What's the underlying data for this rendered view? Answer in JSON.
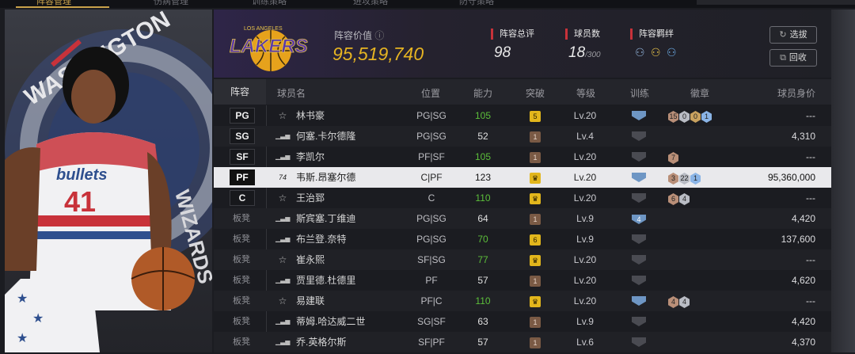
{
  "top_tabs": [
    "阵容管理",
    "伤病管理",
    "训练策略",
    "进攻策略",
    "防守策略"
  ],
  "team": {
    "logo_text": "LAKERS",
    "logo_sub": "LOS ANGELES",
    "lineup_value_label": "阵容价值",
    "lineup_value": "95,519,740",
    "rating_label": "阵容总评",
    "rating": "98",
    "players_label": "球员数",
    "players_count": "18",
    "players_max": "/300",
    "bond_label": "阵容羁绊",
    "bond_icons": [
      "bond-icon-1",
      "bond-icon-2",
      "bond-icon-3"
    ]
  },
  "buttons": {
    "pick": "选拔",
    "recycle": "回收"
  },
  "hero": {
    "jersey_text": "bullets",
    "jersey_number": "41",
    "backdrop_text": "WASHINGTON",
    "backdrop_text2": "WIZARDS"
  },
  "columns": [
    "阵容",
    "球员名",
    "位置",
    "能力",
    "突破",
    "等级",
    "训练",
    "徽章",
    "球员身价"
  ],
  "rows": [
    {
      "slot": "PG",
      "starter": true,
      "icon": "star",
      "name": "林书豪",
      "pos": "PG|SG",
      "ability": "105",
      "ability_color": "green",
      "brk": "5",
      "brk_type": "gold",
      "level": "Lv.20",
      "train": "",
      "train_type": "blue",
      "badges": [
        {
          "t": "15",
          "c": "bronze"
        },
        {
          "t": "0",
          "c": "silver"
        },
        {
          "t": "0",
          "c": "gold"
        },
        {
          "t": "1",
          "c": "blue"
        }
      ],
      "value": "---"
    },
    {
      "slot": "SG",
      "starter": true,
      "icon": "bars",
      "name": "何塞.卡尔德隆",
      "pos": "PG|SG",
      "ability": "52",
      "ability_color": "white",
      "brk": "1",
      "brk_type": "brown",
      "level": "Lv.4",
      "train": "",
      "train_type": "gray",
      "badges": [],
      "value": "4,310"
    },
    {
      "slot": "SF",
      "starter": true,
      "icon": "bars",
      "name": "李凯尔",
      "pos": "PF|SF",
      "ability": "105",
      "ability_color": "green",
      "brk": "1",
      "brk_type": "brown",
      "level": "Lv.20",
      "train": "",
      "train_type": "gray",
      "badges": [
        {
          "t": "7",
          "c": "bronze"
        }
      ],
      "value": "---"
    },
    {
      "slot": "PF",
      "starter": true,
      "icon": "74",
      "name": "韦斯.昂塞尔德",
      "pos": "C|PF",
      "ability": "123",
      "ability_color": "white",
      "brk": "♛",
      "brk_type": "gold",
      "level": "Lv.20",
      "train": "",
      "train_type": "blue",
      "badges": [
        {
          "t": "3",
          "c": "bronze"
        },
        {
          "t": "22",
          "c": "silver"
        },
        {
          "t": "1",
          "c": "blue"
        }
      ],
      "value": "95,360,000",
      "highlight": true
    },
    {
      "slot": "C",
      "starter": true,
      "icon": "star",
      "name": "王治郅",
      "pos": "C",
      "ability": "110",
      "ability_color": "green",
      "brk": "♛",
      "brk_type": "gold",
      "level": "Lv.20",
      "train": "",
      "train_type": "gray",
      "badges": [
        {
          "t": "6",
          "c": "bronze"
        },
        {
          "t": "4",
          "c": "silver"
        }
      ],
      "value": "---"
    },
    {
      "slot": "板凳",
      "starter": false,
      "icon": "bars",
      "name": "斯宾塞.丁维迪",
      "pos": "PG|SG",
      "ability": "64",
      "ability_color": "white",
      "brk": "1",
      "brk_type": "brown",
      "level": "Lv.9",
      "train": "4",
      "train_type": "blue",
      "badges": [],
      "value": "4,420"
    },
    {
      "slot": "板凳",
      "starter": false,
      "icon": "bars",
      "name": "布兰登.奈特",
      "pos": "PG|SG",
      "ability": "70",
      "ability_color": "green",
      "brk": "6",
      "brk_type": "gold",
      "level": "Lv.9",
      "train": "",
      "train_type": "gray",
      "badges": [],
      "value": "137,600"
    },
    {
      "slot": "板凳",
      "starter": false,
      "icon": "star",
      "name": "崔永熙",
      "pos": "SF|SG",
      "ability": "77",
      "ability_color": "green",
      "brk": "♛",
      "brk_type": "gold",
      "level": "Lv.20",
      "train": "",
      "train_type": "gray",
      "badges": [],
      "value": "---"
    },
    {
      "slot": "板凳",
      "starter": false,
      "icon": "bars",
      "name": "贾里德.杜德里",
      "pos": "PF",
      "ability": "57",
      "ability_color": "white",
      "brk": "1",
      "brk_type": "brown",
      "level": "Lv.20",
      "train": "",
      "train_type": "gray",
      "badges": [],
      "value": "4,620"
    },
    {
      "slot": "板凳",
      "starter": false,
      "icon": "star",
      "name": "易建联",
      "pos": "PF|C",
      "ability": "110",
      "ability_color": "green",
      "brk": "♛",
      "brk_type": "gold",
      "level": "Lv.20",
      "train": "",
      "train_type": "blue",
      "badges": [
        {
          "t": "4",
          "c": "bronze"
        },
        {
          "t": "4",
          "c": "silver"
        }
      ],
      "value": "---"
    },
    {
      "slot": "板凳",
      "starter": false,
      "icon": "bars",
      "name": "蒂姆.哈达威二世",
      "pos": "SG|SF",
      "ability": "63",
      "ability_color": "white",
      "brk": "1",
      "brk_type": "brown",
      "level": "Lv.9",
      "train": "",
      "train_type": "gray",
      "badges": [],
      "value": "4,420"
    },
    {
      "slot": "板凳",
      "starter": false,
      "icon": "bars",
      "name": "乔.英格尔斯",
      "pos": "SF|PF",
      "ability": "57",
      "ability_color": "white",
      "brk": "1",
      "brk_type": "brown",
      "level": "Lv.6",
      "train": "",
      "train_type": "gray",
      "badges": [],
      "value": "4,370"
    }
  ]
}
